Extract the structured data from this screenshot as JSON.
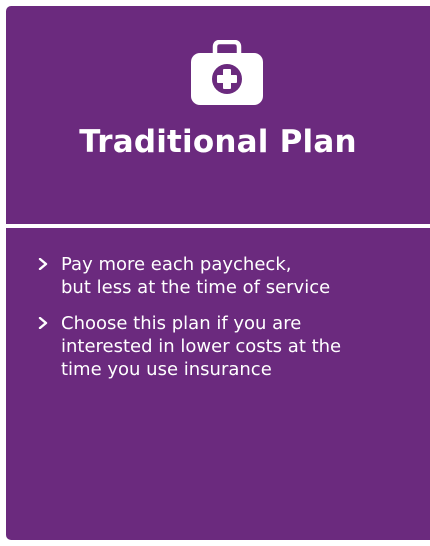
{
  "card": {
    "title": "Traditional Plan",
    "icon": "first-aid-kit-icon",
    "colors": {
      "background": "#6b2a7e",
      "text": "#ffffff",
      "divider": "#ffffff"
    },
    "benefits": [
      {
        "icon": "chevron-right-icon",
        "text": "Pay more each paycheck,\nbut less at the time of service"
      },
      {
        "icon": "chevron-right-icon",
        "text": "Choose this plan if you are\ninterested in lower costs at the\ntime you use insurance"
      }
    ]
  }
}
